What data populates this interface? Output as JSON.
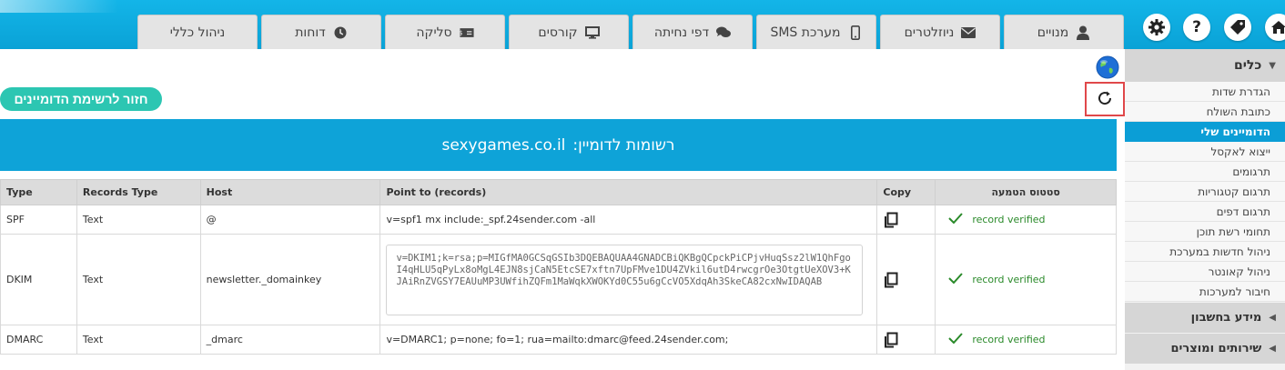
{
  "header": {
    "tabs": [
      {
        "label": "ניהול כללי",
        "icon": "none"
      },
      {
        "label": "דוחות",
        "icon": "clock-icon"
      },
      {
        "label": "סליקה",
        "icon": "money-icon"
      },
      {
        "label": "קורסים",
        "icon": "monitor-icon"
      },
      {
        "label": "דפי נחיתה",
        "icon": "comments-icon"
      },
      {
        "label": "מערכת SMS",
        "icon": "mobile-icon"
      },
      {
        "label": "ניוזלטרים",
        "icon": "envelope-icon"
      },
      {
        "label": "מנויים",
        "icon": "user-icon"
      }
    ],
    "icons": [
      "gear-icon",
      "help-icon",
      "tag-icon",
      "home-icon"
    ]
  },
  "sidebar": {
    "section_title": "כלים",
    "items": [
      {
        "label": "הגדרת שדות"
      },
      {
        "label": "כתובת השולח"
      },
      {
        "label": "הדומיינים שלי",
        "active": true
      },
      {
        "label": "ייצוא לאקסל"
      },
      {
        "label": "תרגומים"
      },
      {
        "label": "תרגום קטגוריות"
      },
      {
        "label": "תרגום דפים"
      },
      {
        "label": "תחומי רשת תוכן"
      },
      {
        "label": "ניהול חדשות במערכת"
      },
      {
        "label": "ניהול קאונטר"
      },
      {
        "label": "חיבור למערכות"
      }
    ],
    "sections": [
      {
        "label": "מידע בחשבון"
      },
      {
        "label": "שירותים ומוצרים"
      }
    ]
  },
  "content": {
    "back_button": "חזור לרשימת הדומיינים",
    "banner_prefix": "רשומות לדומיין:",
    "domain": "sexygames.co.il",
    "columns": [
      "Type",
      "Records Type",
      "Host",
      "Point to (records)",
      "Copy",
      "סטטוס הטמעה"
    ],
    "records": [
      {
        "type": "SPF",
        "records_type": "Text",
        "host": "@",
        "point_to": "v=spf1 mx include:_spf.24sender.com -all",
        "status": "record verified"
      },
      {
        "type": "DKIM",
        "records_type": "Text",
        "host": "newsletter._domainkey",
        "point_to": "v=DKIM1;k=rsa;p=MIGfMA0GCSqGSIb3DQEBAQUAA4GNADCBiQKBgQCpckPiCPjvHuqSsz2lW1QhFgoI4qHLU5qPyLx8oMgL4EJN8sjCaN5EtcSE7xftn7UpFMve1DU4ZVkil6utD4rwcgrOe3OtgtUeXOV3+KJAiRnZVGSY7EAUuMP3UWfihZQFm1MaWqkXWOKYd0C55u6gCcVO5XdqAh3SkeCA82cxNwIDAQAB",
        "status": "record verified"
      },
      {
        "type": "DMARC",
        "records_type": "Text",
        "host": "_dmarc",
        "point_to": "v=DMARC1; p=none; fo=1; rua=mailto:dmarc@feed.24sender.com;",
        "status": "record verified"
      }
    ]
  },
  "colors": {
    "accent": "#0ea3d8",
    "button": "#2cc6b2",
    "verified": "#2a8a2a",
    "highlight": "#e0484a"
  }
}
